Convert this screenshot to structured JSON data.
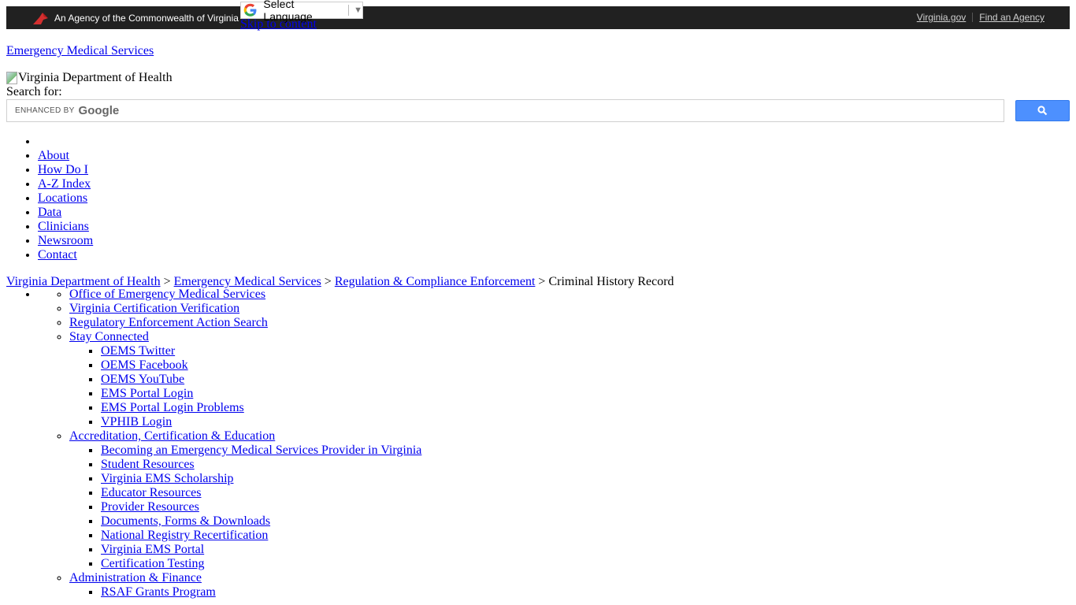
{
  "topbar": {
    "agency_text": "An Agency of the Commonwealth of Virginia",
    "links": [
      "Virginia.gov",
      "Find an Agency"
    ],
    "background_color": "#212121"
  },
  "translate": {
    "label": "Select Language",
    "arrow": "▼"
  },
  "skip_link": "Skip to content",
  "site_title": "Emergency Medical Services",
  "logo_alt": "Virginia Department of Health",
  "search": {
    "label": "Search for:",
    "enhanced_by": "ENHANCED BY",
    "brand": "Google",
    "button_color": "#4d90fe"
  },
  "main_nav": [
    "",
    "About",
    "How Do I",
    "A-Z Index",
    "Locations",
    "Data",
    "Clinicians",
    "Newsroom",
    "Contact"
  ],
  "breadcrumb": {
    "items": [
      "Virginia Department of Health",
      "Emergency Medical Services",
      "Regulation & Compliance Enforcement"
    ],
    "separator": ">",
    "current": "Criminal History Record"
  },
  "side_nav": {
    "top": [
      "Office of Emergency Medical Services",
      "Virginia Certification Verification",
      "Regulatory Enforcement Action Search"
    ],
    "stay_connected": {
      "label": "Stay Connected",
      "items": [
        "OEMS Twitter",
        "OEMS Facebook",
        "OEMS YouTube",
        "EMS Portal Login",
        "EMS Portal Login Problems",
        "VPHIB Login"
      ]
    },
    "accreditation": {
      "label": "Accreditation, Certification & Education",
      "items": [
        "Becoming an Emergency Medical Services Provider in Virginia",
        "Student Resources",
        "Virginia EMS Scholarship",
        "Educator Resources",
        "Provider Resources",
        "Documents, Forms & Downloads",
        "National Registry Recertification",
        "Virginia EMS Portal",
        "Certification Testing"
      ]
    },
    "administration": {
      "label": "Administration & Finance",
      "items": [
        "RSAF Grants Program"
      ]
    }
  }
}
